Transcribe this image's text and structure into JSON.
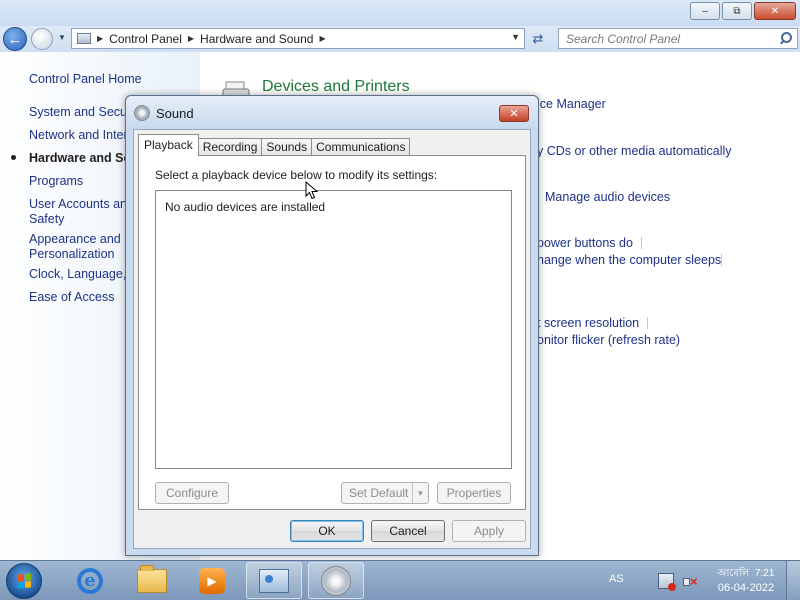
{
  "explorer": {
    "caption": {
      "minimize": "–",
      "maximize": "⧉",
      "close": "✕"
    },
    "breadcrumb": [
      "Control Panel",
      "Hardware and Sound"
    ],
    "search_placeholder": "Search Control Panel",
    "sidebar": {
      "home": "Control Panel Home",
      "items": [
        "System and Securi",
        "Network and Inter",
        "Hardware and So",
        "Programs",
        "User Accounts and",
        "Safety",
        "Appearance and",
        "Personalization",
        "Clock, Language, a",
        "Ease of Access"
      ],
      "active_item": "Hardware and So"
    },
    "content": {
      "category_title": "Devices and Printers",
      "links": [
        "ice Manager",
        "y CDs or other media automatically",
        "Manage audio devices",
        "power buttons do",
        "hange when the computer sleeps",
        "t screen resolution",
        "onitor flicker (refresh rate)"
      ]
    }
  },
  "dialog": {
    "title": "Sound",
    "close": "✕",
    "tabs": [
      "Playback",
      "Recording",
      "Sounds",
      "Communications"
    ],
    "active_tab": "Playback",
    "instruction": "Select a playback device below to modify its settings:",
    "empty_message": "No audio devices are installed",
    "buttons": {
      "configure": "Configure",
      "set_default": "Set Default",
      "properties": "Properties",
      "ok": "OK",
      "cancel": "Cancel",
      "apply": "Apply"
    }
  },
  "taskbar": {
    "language": "AS",
    "clock_day": "আবেলি",
    "clock_time": "7:21",
    "clock_date": "06-04-2022",
    "pinned": [
      "internet-explorer-icon",
      "windows-explorer-icon",
      "media-player-icon",
      "control-panel-icon",
      "sound-icon"
    ]
  },
  "colors": {
    "link": "#1e3287",
    "category_title": "#1e7a3c",
    "taskbar": "#7d98ba",
    "close_red": "#c43f26"
  }
}
